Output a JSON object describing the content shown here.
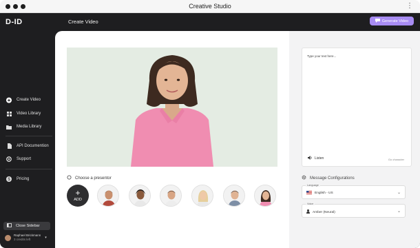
{
  "window": {
    "title": "Creative Studio"
  },
  "sidebar": {
    "logo": "D-ID",
    "items": [
      {
        "label": "Create Video",
        "icon": "plus-circle-icon"
      },
      {
        "label": "Video Library",
        "icon": "grid-icon"
      },
      {
        "label": "Media Library",
        "icon": "folder-icon"
      },
      {
        "label": "API Documention",
        "icon": "api-icon"
      },
      {
        "label": "Support",
        "icon": "support-icon"
      },
      {
        "label": "Pricing",
        "icon": "dollar-icon"
      }
    ],
    "close_label": "Close Sidebar",
    "user": {
      "name": "Raphael Brickmann",
      "credits": "3 credits left"
    }
  },
  "topbar": {
    "title": "Create Video",
    "generate_label": "Generate Video"
  },
  "presenters": {
    "label": "Choose a presentor",
    "add_label": "ADD"
  },
  "script_panel": {
    "placeholder": "Type your text here...",
    "listen_label": "Listen",
    "char_count": "Go character"
  },
  "config": {
    "title": "Message Configurations",
    "language": {
      "legend": "Language",
      "value": "English - US"
    },
    "voice": {
      "legend": "Voice",
      "value": "Amber (Neural)"
    }
  },
  "colors": {
    "accent": "#a88cf3",
    "sidebar_bg": "#1e1e20",
    "video_bg": "#e4ece3",
    "shirt": "#f08db1"
  }
}
